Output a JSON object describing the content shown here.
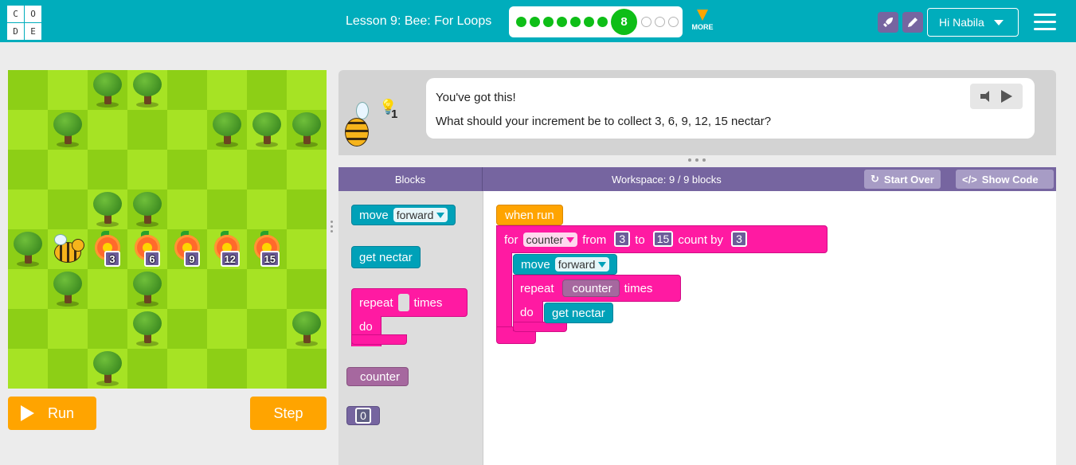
{
  "header": {
    "logo_letters": [
      "C",
      "O",
      "D",
      "E"
    ],
    "lesson_title": "Lesson 9: Bee: For Loops",
    "progress": {
      "completed": 7,
      "current": "8",
      "remaining": 3
    },
    "more_label": "MORE",
    "user_label": "Hi Nabila",
    "icons": [
      "rocket-icon",
      "pencil-icon",
      "hamburger-icon"
    ]
  },
  "maze": {
    "flower_counts": [
      "3",
      "6",
      "9",
      "12",
      "15"
    ]
  },
  "controls": {
    "run_label": "Run",
    "step_label": "Step"
  },
  "instructions": {
    "hint_count": "1",
    "line1": "You've got this!",
    "line2": "What should your increment be to collect 3, 6, 9, 12, 15 nectar?"
  },
  "workspace_header": {
    "toolbox_label": "Blocks",
    "workspace_label": "Workspace: 9 / 9 blocks",
    "start_over_label": "Start Over",
    "show_code_label": "Show Code"
  },
  "toolbox": {
    "move_label": "move",
    "move_dir": "forward",
    "get_nectar_label": "get nectar",
    "repeat_label": "repeat",
    "times_label": "times",
    "do_label": "do",
    "counter_label": "counter",
    "number_value": "0"
  },
  "program": {
    "when_run_label": "when run",
    "for_label": "for",
    "for_var": "counter",
    "from_label": "from",
    "from_value": "3",
    "to_label": "to",
    "to_value": "15",
    "count_by_label": "count by",
    "count_by_value": "3",
    "move_label": "move",
    "move_dir": "forward",
    "repeat_label": "repeat",
    "repeat_var": "counter",
    "times_label": "times",
    "do_label": "do",
    "get_nectar_label": "get nectar"
  }
}
